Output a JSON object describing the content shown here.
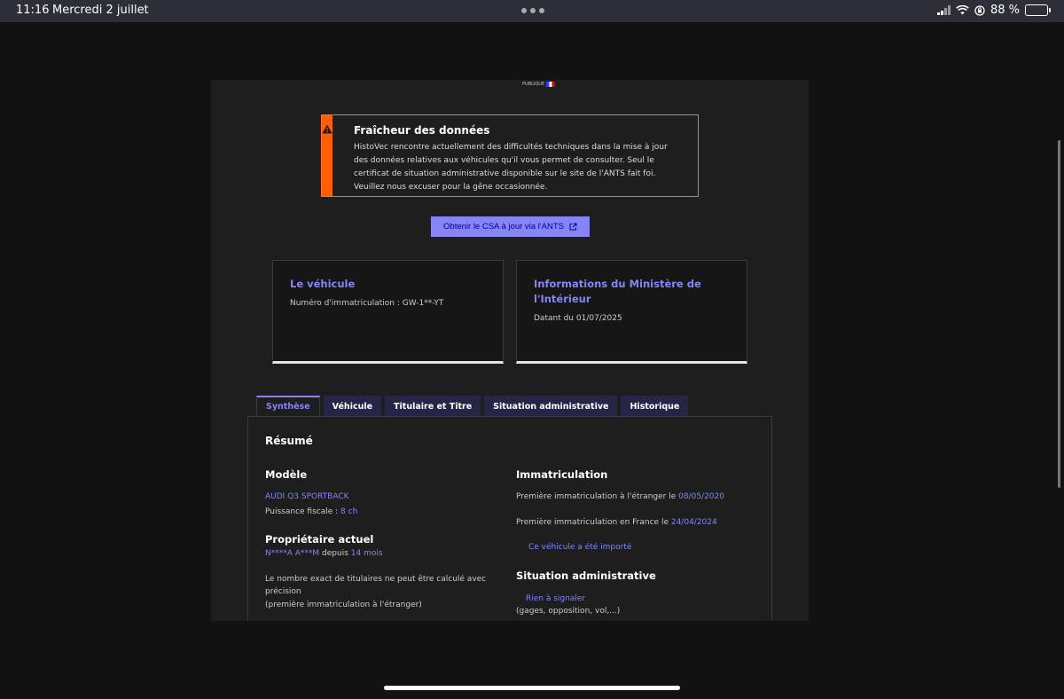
{
  "status_bar": {
    "time": "11:16",
    "date": "Mercredi 2 juillet",
    "battery": "88 %",
    "battery_level": 0.88
  },
  "logo": {
    "text": "PUBLIQUE"
  },
  "alert": {
    "icon": "warning-icon",
    "title": "Fraîcheur des données",
    "text": "HistoVec rencontre actuellement des difficultés techniques dans la mise à jour des données relatives aux véhicules qu'il vous permet de consulter. Seul le certificat de situation administrative disponible sur le site de l'ANTS fait foi. Veuillez nous excuser pour la gêne occasionnée."
  },
  "csa_button": {
    "label": "Obtenir le CSA à jour via l'ANTS",
    "icon": "external-link-icon"
  },
  "cards": {
    "vehicle": {
      "title": "Le véhicule",
      "text": "Numéro d'immatriculation : GW-1**-YT"
    },
    "ministry": {
      "title": "Informations du Ministère de l'Intérieur",
      "text": "Datant du 01/07/2025"
    }
  },
  "tabs": [
    "Synthèse",
    "Véhicule",
    "Titulaire et Titre",
    "Situation administrative",
    "Historique"
  ],
  "summary": {
    "title": "Résumé",
    "model": {
      "heading": "Modèle",
      "name": "AUDI Q3 SPORTBACK",
      "power_label": "Puissance fiscale : ",
      "power_value": "8 ch"
    },
    "owner": {
      "heading": "Propriétaire actuel",
      "name": "N****A A***M",
      "since_label": " depuis ",
      "since_value": "14 mois",
      "note_line1": "Le nombre exact de titulaires ne peut être calculé avec précision",
      "note_line2": "(première immatriculation à l'étranger)"
    },
    "registration": {
      "heading": "Immatriculation",
      "abroad_label": "Première immatriculation à l'étranger le ",
      "abroad_date": "08/05/2020",
      "france_label": "Première immatriculation en France le ",
      "france_date": "24/04/2024",
      "imported": "Ce véhicule a été importé"
    },
    "admin": {
      "heading": "Situation administrative",
      "status": "Rien à signaler",
      "detail": "(gages, opposition, vol,...)"
    }
  }
}
